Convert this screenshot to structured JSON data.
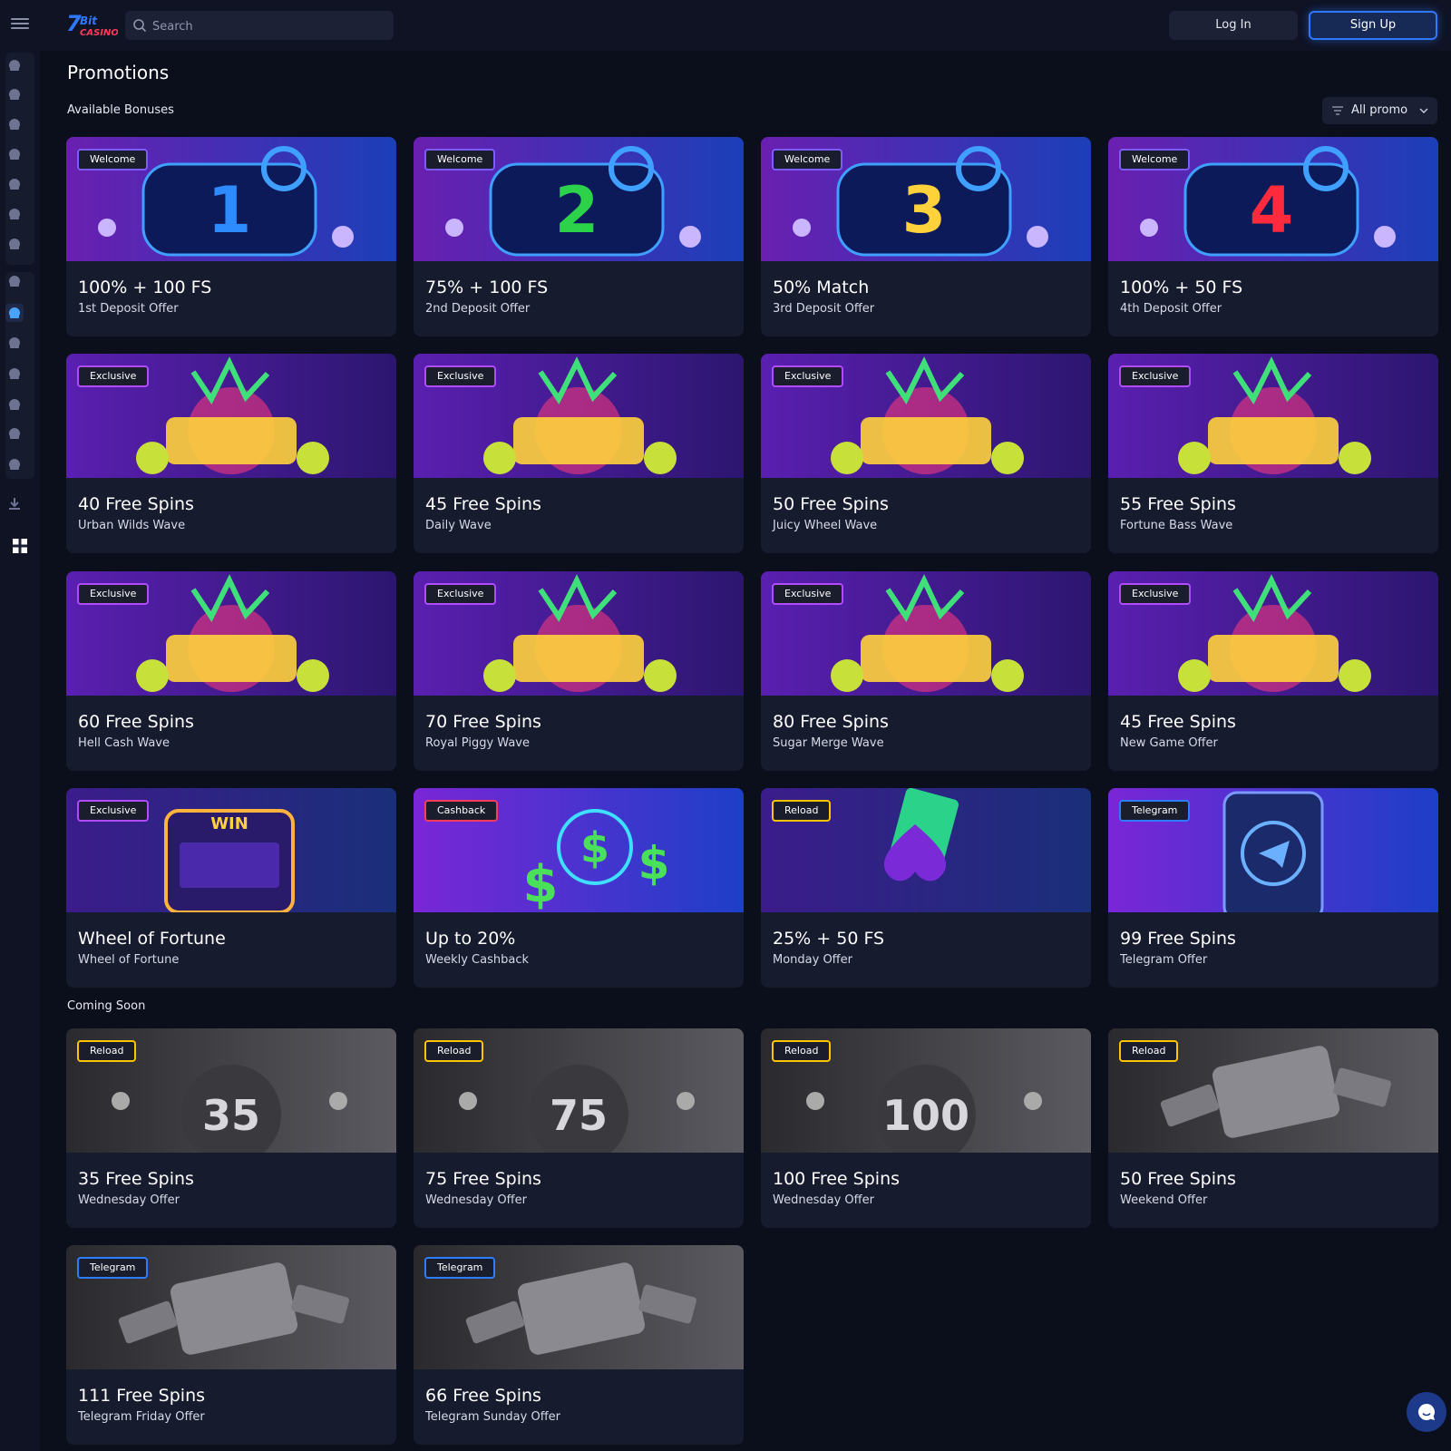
{
  "header": {
    "search_placeholder": "Search",
    "login_label": "Log In",
    "signup_label": "Sign Up",
    "logo_text": "7Bit Casino"
  },
  "page": {
    "title": "Promotions",
    "available_label": "Available Bonuses",
    "coming_soon_label": "Coming Soon",
    "filter_label": "All promo"
  },
  "colors": {
    "background": "#0b0e1b",
    "card": "#171b2e",
    "accent": "#2e78ff",
    "welcome": "#7b5cff",
    "exclusive": "#b04bff",
    "cashback": "#ff3b5c",
    "reload": "#ffc400",
    "telegram": "#2f7dff"
  },
  "sidebar_icons": [
    "fire-icon",
    "slots-icon",
    "lightning-icon",
    "live-icon",
    "bonus-buy-icon",
    "table-games-icon",
    "rocket-icon",
    "video-icon",
    "gift-icon",
    "trophy-icon",
    "vip-icon",
    "crown-icon",
    "card-icon",
    "shop-icon",
    "download-icon",
    "language-icon"
  ],
  "available": [
    {
      "badge": "Welcome",
      "title": "100% + 100 FS",
      "sub": "1st Deposit Offer",
      "art": "slot-1"
    },
    {
      "badge": "Welcome",
      "title": "75% + 100 FS",
      "sub": "2nd Deposit Offer",
      "art": "slot-2"
    },
    {
      "badge": "Welcome",
      "title": "50% Match",
      "sub": "3rd Deposit Offer",
      "art": "slot-3"
    },
    {
      "badge": "Welcome",
      "title": "100% + 50 FS",
      "sub": "4th Deposit Offer",
      "art": "slot-4"
    },
    {
      "badge": "Exclusive",
      "title": "40 Free Spins",
      "sub": "Urban Wilds Wave",
      "art": "riot-urban-wilds"
    },
    {
      "badge": "Exclusive",
      "title": "45 Free Spins",
      "sub": "Daily Wave",
      "art": "the-bonus-day"
    },
    {
      "badge": "Exclusive",
      "title": "50 Free Spins",
      "sub": "Juicy Wheel Wave",
      "art": "juicy-wheel"
    },
    {
      "badge": "Exclusive",
      "title": "55 Free Spins",
      "sub": "Fortune Bass Wave",
      "art": "danludans-fortune-bass"
    },
    {
      "badge": "Exclusive",
      "title": "60 Free Spins",
      "sub": "Hell Cash Wave",
      "art": "hell-cash"
    },
    {
      "badge": "Exclusive",
      "title": "70 Free Spins",
      "sub": "Royal Piggy Wave",
      "art": "royal-piggy"
    },
    {
      "badge": "Exclusive",
      "title": "80 Free Spins",
      "sub": "Sugar Merge Wave",
      "art": "sugar-merge-up"
    },
    {
      "badge": "Exclusive",
      "title": "45 Free Spins",
      "sub": "New Game Offer",
      "art": "retro-fruits"
    },
    {
      "badge": "Exclusive",
      "title": "Wheel of Fortune",
      "sub": "Wheel of Fortune",
      "art": "win-slot-machine"
    },
    {
      "badge": "Cashback",
      "title": "Up to 20%",
      "sub": "Weekly Cashback",
      "art": "dollar-cashback"
    },
    {
      "badge": "Reload",
      "title": "25% + 50 FS",
      "sub": "Monday Offer",
      "art": "spade-cards"
    },
    {
      "badge": "Telegram",
      "title": "99 Free Spins",
      "sub": "Telegram Offer",
      "art": "telegram-phone"
    }
  ],
  "coming_soon": [
    {
      "badge": "Reload",
      "title": "35 Free Spins",
      "sub": "Wednesday Offer",
      "art": "bomb-35"
    },
    {
      "badge": "Reload",
      "title": "75 Free Spins",
      "sub": "Wednesday Offer",
      "art": "bomb-75"
    },
    {
      "badge": "Reload",
      "title": "100 Free Spins",
      "sub": "Wednesday Offer",
      "art": "bomb-100"
    },
    {
      "badge": "Reload",
      "title": "50 Free Spins",
      "sub": "Weekend Offer",
      "art": "money-jars"
    },
    {
      "badge": "Telegram",
      "title": "111 Free Spins",
      "sub": "Telegram Friday Offer",
      "art": "bonus-gun"
    },
    {
      "badge": "Telegram",
      "title": "66 Free Spins",
      "sub": "Telegram Sunday Offer",
      "art": "bonus-gun"
    }
  ]
}
